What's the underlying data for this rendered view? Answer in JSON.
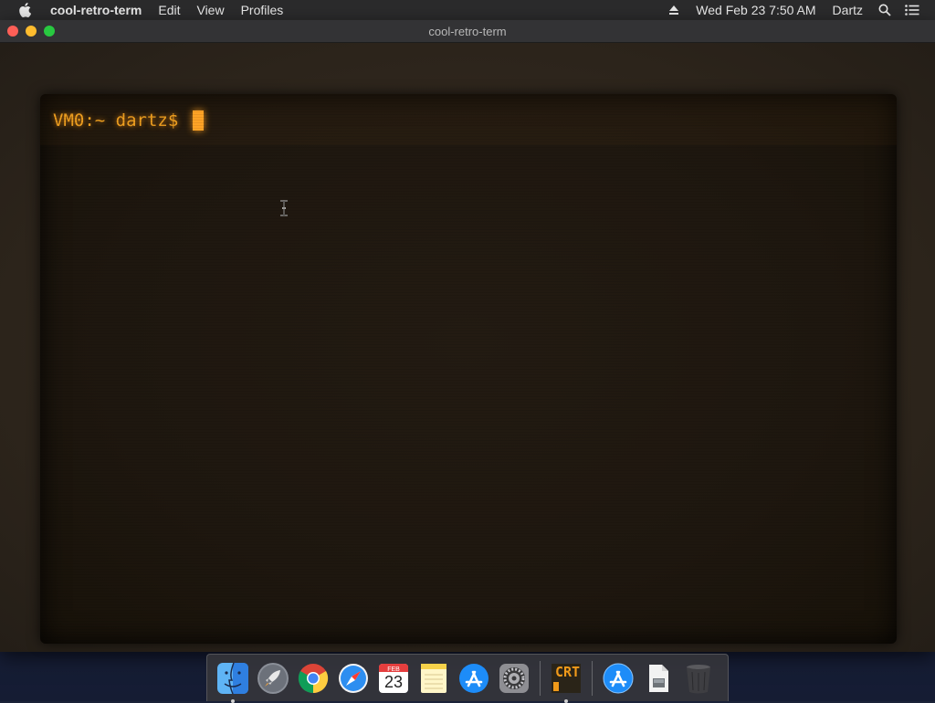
{
  "menubar": {
    "apple_icon": "apple-icon",
    "app_name": "cool-retro-term",
    "menus": [
      "Edit",
      "View",
      "Profiles"
    ],
    "eject_icon": "eject-icon",
    "datetime": "Wed Feb 23  7:50 AM",
    "user": "Dartz",
    "search_icon": "spotlight-search-icon",
    "notification_icon": "notification-center-icon"
  },
  "window": {
    "title": "cool-retro-term",
    "buttons": [
      "close",
      "minimize",
      "zoom"
    ]
  },
  "terminal": {
    "prompt": "VM0:~ dartz$ ",
    "text_color": "#f0a020",
    "cursor_color": "#ffa326"
  },
  "dock": {
    "items": [
      {
        "name": "Finder",
        "icon": "finder-icon",
        "running": true
      },
      {
        "name": "Launchpad",
        "icon": "launchpad-icon",
        "running": false
      },
      {
        "name": "Google Chrome",
        "icon": "chrome-icon",
        "running": false
      },
      {
        "name": "Safari",
        "icon": "safari-icon",
        "running": false
      },
      {
        "name": "Calendar",
        "icon": "calendar-icon",
        "running": false
      },
      {
        "name": "Notes",
        "icon": "notes-icon",
        "running": false
      },
      {
        "name": "App Store",
        "icon": "app-store-icon",
        "running": false
      },
      {
        "name": "System Preferences",
        "icon": "system-preferences-icon",
        "running": false
      },
      {
        "name": "cool-retro-term",
        "icon": "crt-icon",
        "running": true
      },
      {
        "name": "Applications",
        "icon": "applications-folder-icon",
        "running": false
      },
      {
        "name": "Document",
        "icon": "document-icon",
        "running": false
      },
      {
        "name": "Trash",
        "icon": "trash-icon",
        "running": false
      }
    ],
    "calendar": {
      "month": "FEB",
      "day": "23"
    },
    "crt_label": "CRT"
  }
}
